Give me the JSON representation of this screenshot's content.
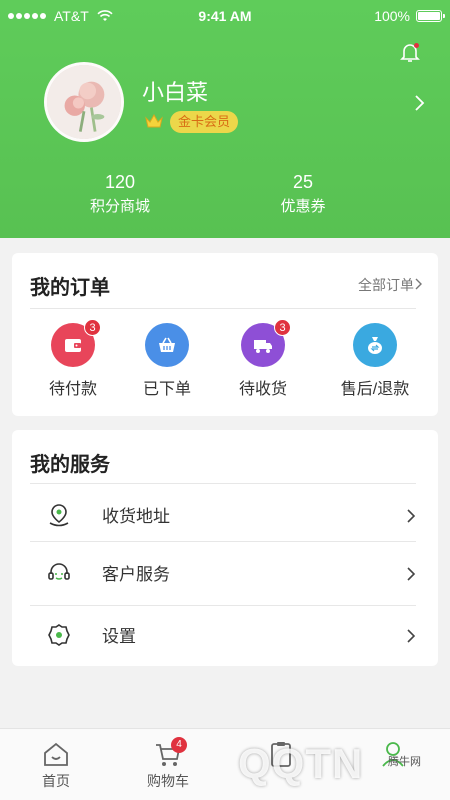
{
  "status_bar": {
    "carrier": "AT&T",
    "time": "9:41 AM",
    "battery": "100%"
  },
  "profile": {
    "username": "小白菜",
    "member_level": "金卡会员"
  },
  "stats": [
    {
      "value": "120",
      "label": "积分商城"
    },
    {
      "value": "25",
      "label": "优惠券"
    }
  ],
  "orders": {
    "title": "我的订单",
    "all_link": "全部订单",
    "items": [
      {
        "label": "待付款",
        "badge": "3",
        "icon": "wallet-icon",
        "color": "#e8455a"
      },
      {
        "label": "已下单",
        "badge": "",
        "icon": "basket-icon",
        "color": "#4a8fe7"
      },
      {
        "label": "待收货",
        "badge": "3",
        "icon": "truck-icon",
        "color": "#8e4fd6"
      },
      {
        "label": "售后/退款",
        "badge": "",
        "icon": "money-bag-icon",
        "color": "#3aa9e0"
      }
    ]
  },
  "services": {
    "title": "我的服务",
    "items": [
      {
        "label": "收货地址",
        "icon": "location-icon"
      },
      {
        "label": "客户服务",
        "icon": "headset-icon"
      },
      {
        "label": "设置",
        "icon": "gear-icon"
      }
    ]
  },
  "tabbar": {
    "items": [
      {
        "label": "首页",
        "icon": "home-icon"
      },
      {
        "label": "购物车",
        "icon": "cart-icon",
        "badge": "4"
      },
      {
        "label": "",
        "icon": "clipboard-icon"
      },
      {
        "label": "",
        "icon": "person-icon"
      }
    ]
  },
  "watermark": "QQTN",
  "watermark_small": "腾牛网",
  "colors": {
    "brand_green": "#5fcc5a",
    "badge_red": "#e0323f",
    "gold": "#ecd74a"
  }
}
